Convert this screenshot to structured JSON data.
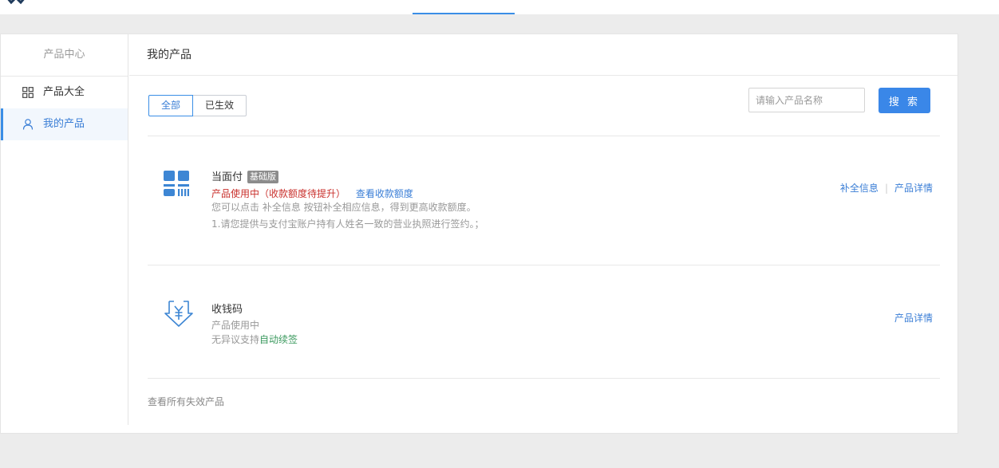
{
  "sidebar": {
    "title": "产品中心",
    "items": [
      {
        "label": "产品大全",
        "icon": "grid-icon"
      },
      {
        "label": "我的产品",
        "icon": "user-icon"
      }
    ]
  },
  "main": {
    "header": "我的产品",
    "tabs": [
      {
        "label": "全部",
        "selected": true
      },
      {
        "label": "已生效",
        "selected": false
      }
    ],
    "search": {
      "placeholder": "请输入产品名称",
      "button": "搜 索"
    },
    "products": [
      {
        "name": "当面付",
        "badge": "基础版",
        "icon": "qr-code-icon",
        "status": "产品使用中（收款额度待提升）",
        "status_link": "查看收款额度",
        "note1": "您可以点击 补全信息 按钮补全相应信息，得到更高收款额度。",
        "note2": "1.请您提供与支付宝账户持有人姓名一致的营业执照进行签约。；",
        "actions": [
          "补全信息",
          "产品详情"
        ],
        "separator": "|"
      },
      {
        "name": "收钱码",
        "icon": "yen-receive-icon",
        "status": "产品使用中",
        "note_prefix": "无异议支持",
        "note_highlight": "自动续签",
        "actions": [
          "产品详情"
        ]
      }
    ],
    "footer_link": "查看所有失效产品"
  },
  "colors": {
    "accent": "#3a8ee6",
    "button": "#3a87e8",
    "status_red": "#c9302c",
    "highlight_green": "#3c9a5f",
    "badge_gray": "#8c8c8c",
    "background": "#ececec"
  }
}
